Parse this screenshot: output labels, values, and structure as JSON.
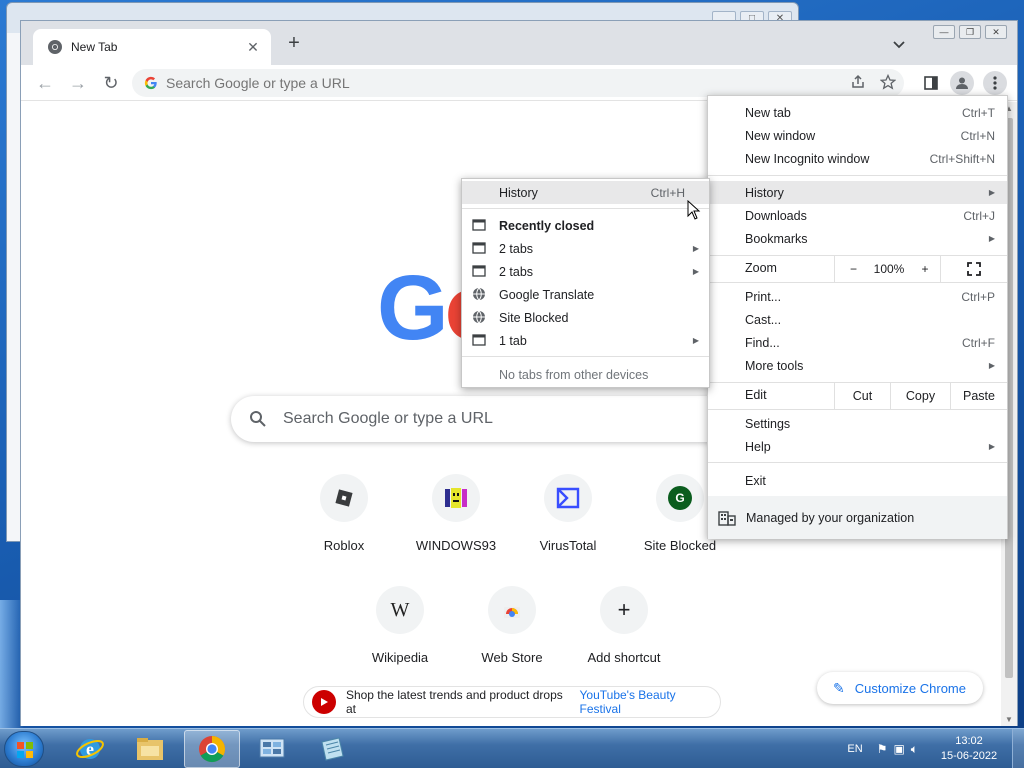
{
  "tab": {
    "title": "New Tab"
  },
  "omnibox": {
    "placeholder": "Search Google or type a URL"
  },
  "ntp": {
    "logo": [
      "G",
      "o"
    ],
    "search_placeholder": "Search Google or type a URL",
    "shortcuts_row1": [
      "Roblox",
      "WINDOWS93",
      "VirusTotal",
      "Site Blocked"
    ],
    "shortcuts_row2": [
      "Wikipedia",
      "Web Store",
      "Add shortcut"
    ],
    "wikipedia_glyph": "W",
    "site_blocked_glyph": "G",
    "add_glyph": "+",
    "promo_text": "Shop the latest trends and product drops at",
    "promo_link": "YouTube's Beauty Festival",
    "customize": "Customize Chrome"
  },
  "menu": {
    "new_tab": "New tab",
    "new_tab_sc": "Ctrl+T",
    "new_window": "New window",
    "new_window_sc": "Ctrl+N",
    "incognito": "New Incognito window",
    "incognito_sc": "Ctrl+Shift+N",
    "history": "History",
    "downloads": "Downloads",
    "downloads_sc": "Ctrl+J",
    "bookmarks": "Bookmarks",
    "zoom": "Zoom",
    "zoom_minus": "−",
    "zoom_value": "100%",
    "zoom_plus": "+",
    "print": "Print...",
    "print_sc": "Ctrl+P",
    "cast": "Cast...",
    "find": "Find...",
    "find_sc": "Ctrl+F",
    "more_tools": "More tools",
    "edit": "Edit",
    "cut": "Cut",
    "copy": "Copy",
    "paste": "Paste",
    "settings": "Settings",
    "help": "Help",
    "exit": "Exit",
    "managed": "Managed by your organization"
  },
  "history_submenu": {
    "history": "History",
    "history_sc": "Ctrl+H",
    "recently_closed": "Recently closed",
    "items": [
      "2 tabs",
      "2 tabs",
      "Google Translate",
      "Site Blocked",
      "1 tab"
    ],
    "no_tabs": "No tabs from other devices"
  },
  "taskbar": {
    "lang": "EN",
    "time": "13:02",
    "date": "15-06-2022"
  },
  "colors": {
    "accent": "#1a73e8",
    "youtube": "#cc0000",
    "virustotal": "#394eff",
    "site_blocked": "#0b5d1e"
  }
}
